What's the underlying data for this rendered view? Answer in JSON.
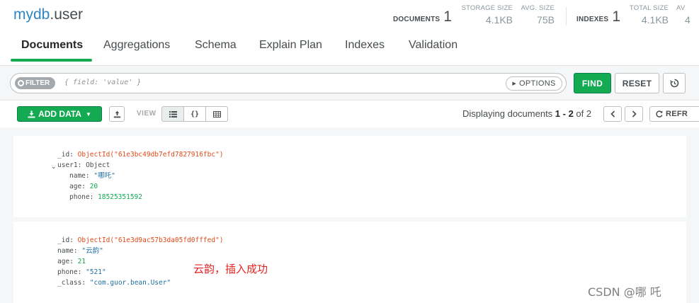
{
  "header": {
    "db_name": "mydb",
    "collection_name": ".user",
    "stats": {
      "documents_label": "DOCUMENTS",
      "documents_value": "1",
      "storage_size_label": "STORAGE SIZE",
      "storage_size_value": "4.1KB",
      "avg_size_label": "AVG. SIZE",
      "avg_size_value": "75B",
      "indexes_label": "INDEXES",
      "indexes_value": "1",
      "total_size_label": "TOTAL SIZE",
      "total_size_value": "4.1KB",
      "avg_index_label": "AV",
      "avg_index_value": "4"
    }
  },
  "tabs": [
    {
      "label": "Documents",
      "active": true
    },
    {
      "label": "Aggregations",
      "active": false
    },
    {
      "label": "Schema",
      "active": false
    },
    {
      "label": "Explain Plan",
      "active": false
    },
    {
      "label": "Indexes",
      "active": false
    },
    {
      "label": "Validation",
      "active": false
    }
  ],
  "querybar": {
    "filter_label": "FILTER",
    "filter_placeholder": "{ field: 'value' }",
    "options_label": "OPTIONS",
    "find_label": "FIND",
    "reset_label": "RESET"
  },
  "toolbar": {
    "add_data_label": "ADD DATA",
    "view_label": "VIEW",
    "paging_prefix": "Displaying documents ",
    "paging_range": "1 - 2",
    "paging_of": " of ",
    "paging_total": "2",
    "refresh_label": "REFR"
  },
  "documents": [
    {
      "fields": [
        {
          "key": "_id",
          "value": "ObjectId(\"61e3bc49db7efd7827916fbc\")",
          "type": "oid"
        },
        {
          "key": "user1",
          "value": "Object",
          "type": "obj",
          "expanded": true
        },
        {
          "key": "name",
          "value": "\"哪吒\"",
          "type": "str",
          "nested": true
        },
        {
          "key": "age",
          "value": "20",
          "type": "num",
          "nested": true
        },
        {
          "key": "phone",
          "value": "18525351592",
          "type": "num",
          "nested": true
        }
      ]
    },
    {
      "fields": [
        {
          "key": "_id",
          "value": "ObjectId(\"61e3d9ac57b3da05fd0fffed\")",
          "type": "oid"
        },
        {
          "key": "name",
          "value": "\"云韵\"",
          "type": "str"
        },
        {
          "key": "age",
          "value": "21",
          "type": "num"
        },
        {
          "key": "phone",
          "value": "\"521\"",
          "type": "str"
        },
        {
          "key": "_class",
          "value": "\"com.guor.bean.User\"",
          "type": "str"
        }
      ]
    }
  ],
  "annotation": "云韵，插入成功",
  "watermark": "CSDN @哪 吒",
  "colors": {
    "accent_green": "#13aa52",
    "objectid_orange": "#e04a1a",
    "string_blue": "#1f6fa0",
    "annotation_red": "#e52220"
  },
  "icons": {
    "filter": "filter-dot-icon",
    "options_caret": "caret-right-icon",
    "history": "history-icon",
    "add_data": "download-icon",
    "export": "export-icon",
    "view_list": "list-icon",
    "view_json": "json-braces-icon",
    "view_table": "table-icon",
    "refresh": "refresh-icon"
  }
}
